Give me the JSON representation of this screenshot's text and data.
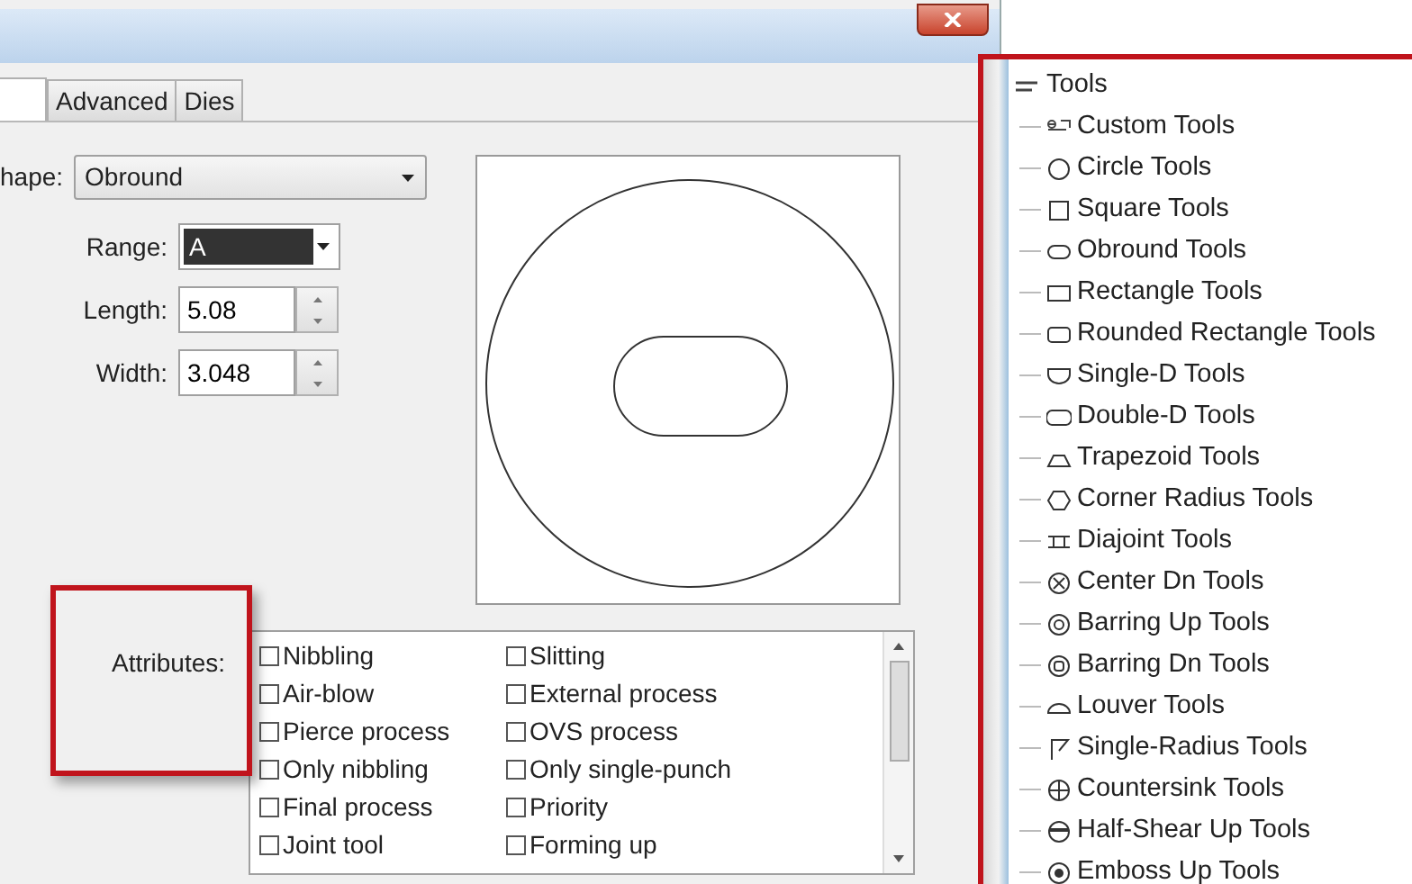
{
  "tabs": [
    {
      "label": "Advanced",
      "selected": false
    },
    {
      "label": "Dies",
      "selected": false
    }
  ],
  "form": {
    "shape_label": "hape:",
    "shape_value": "Obround",
    "range_label": "Range:",
    "range_value": "A",
    "range_highlighted": true,
    "length_label": "Length:",
    "length_value": "5.08",
    "width_label": "Width:",
    "width_value": "3.048",
    "attributes_label": "Attributes:"
  },
  "attributes": [
    {
      "label": "Nibbling",
      "checked": false
    },
    {
      "label": "Slitting",
      "checked": false
    },
    {
      "label": "Air-blow",
      "checked": false
    },
    {
      "label": "External process",
      "checked": false
    },
    {
      "label": "Pierce process",
      "checked": false
    },
    {
      "label": "OVS process",
      "checked": false
    },
    {
      "label": "Only nibbling",
      "checked": false
    },
    {
      "label": "Only single-punch",
      "checked": false
    },
    {
      "label": "Final process",
      "checked": false
    },
    {
      "label": "Priority",
      "checked": false
    },
    {
      "label": "Joint tool",
      "checked": false
    },
    {
      "label": "Forming up",
      "checked": false
    }
  ],
  "tree": {
    "label": "Tools",
    "children": [
      {
        "label": "Custom Tools"
      },
      {
        "label": "Circle Tools"
      },
      {
        "label": "Square Tools"
      },
      {
        "label": "Obround Tools"
      },
      {
        "label": "Rectangle Tools"
      },
      {
        "label": "Rounded Rectangle Tools"
      },
      {
        "label": "Single-D Tools"
      },
      {
        "label": "Double-D Tools"
      },
      {
        "label": "Trapezoid Tools"
      },
      {
        "label": "Corner Radius Tools"
      },
      {
        "label": "Diajoint Tools"
      },
      {
        "label": "Center Dn Tools"
      },
      {
        "label": "Barring Up Tools"
      },
      {
        "label": "Barring Dn Tools"
      },
      {
        "label": "Louver Tools"
      },
      {
        "label": "Single-Radius Tools"
      },
      {
        "label": "Countersink Tools"
      },
      {
        "label": "Half-Shear Up Tools"
      },
      {
        "label": "Emboss Up Tools"
      }
    ]
  }
}
